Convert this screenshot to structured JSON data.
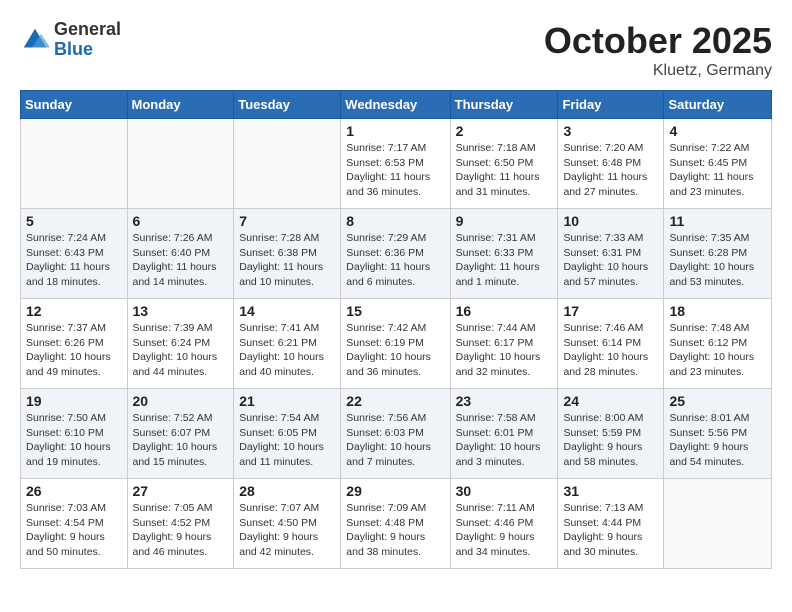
{
  "header": {
    "logo_general": "General",
    "logo_blue": "Blue",
    "month": "October 2025",
    "location": "Kluetz, Germany"
  },
  "weekdays": [
    "Sunday",
    "Monday",
    "Tuesday",
    "Wednesday",
    "Thursday",
    "Friday",
    "Saturday"
  ],
  "weeks": [
    [
      {
        "day": "",
        "info": ""
      },
      {
        "day": "",
        "info": ""
      },
      {
        "day": "",
        "info": ""
      },
      {
        "day": "1",
        "info": "Sunrise: 7:17 AM\nSunset: 6:53 PM\nDaylight: 11 hours\nand 36 minutes."
      },
      {
        "day": "2",
        "info": "Sunrise: 7:18 AM\nSunset: 6:50 PM\nDaylight: 11 hours\nand 31 minutes."
      },
      {
        "day": "3",
        "info": "Sunrise: 7:20 AM\nSunset: 6:48 PM\nDaylight: 11 hours\nand 27 minutes."
      },
      {
        "day": "4",
        "info": "Sunrise: 7:22 AM\nSunset: 6:45 PM\nDaylight: 11 hours\nand 23 minutes."
      }
    ],
    [
      {
        "day": "5",
        "info": "Sunrise: 7:24 AM\nSunset: 6:43 PM\nDaylight: 11 hours\nand 18 minutes."
      },
      {
        "day": "6",
        "info": "Sunrise: 7:26 AM\nSunset: 6:40 PM\nDaylight: 11 hours\nand 14 minutes."
      },
      {
        "day": "7",
        "info": "Sunrise: 7:28 AM\nSunset: 6:38 PM\nDaylight: 11 hours\nand 10 minutes."
      },
      {
        "day": "8",
        "info": "Sunrise: 7:29 AM\nSunset: 6:36 PM\nDaylight: 11 hours\nand 6 minutes."
      },
      {
        "day": "9",
        "info": "Sunrise: 7:31 AM\nSunset: 6:33 PM\nDaylight: 11 hours\nand 1 minute."
      },
      {
        "day": "10",
        "info": "Sunrise: 7:33 AM\nSunset: 6:31 PM\nDaylight: 10 hours\nand 57 minutes."
      },
      {
        "day": "11",
        "info": "Sunrise: 7:35 AM\nSunset: 6:28 PM\nDaylight: 10 hours\nand 53 minutes."
      }
    ],
    [
      {
        "day": "12",
        "info": "Sunrise: 7:37 AM\nSunset: 6:26 PM\nDaylight: 10 hours\nand 49 minutes."
      },
      {
        "day": "13",
        "info": "Sunrise: 7:39 AM\nSunset: 6:24 PM\nDaylight: 10 hours\nand 44 minutes."
      },
      {
        "day": "14",
        "info": "Sunrise: 7:41 AM\nSunset: 6:21 PM\nDaylight: 10 hours\nand 40 minutes."
      },
      {
        "day": "15",
        "info": "Sunrise: 7:42 AM\nSunset: 6:19 PM\nDaylight: 10 hours\nand 36 minutes."
      },
      {
        "day": "16",
        "info": "Sunrise: 7:44 AM\nSunset: 6:17 PM\nDaylight: 10 hours\nand 32 minutes."
      },
      {
        "day": "17",
        "info": "Sunrise: 7:46 AM\nSunset: 6:14 PM\nDaylight: 10 hours\nand 28 minutes."
      },
      {
        "day": "18",
        "info": "Sunrise: 7:48 AM\nSunset: 6:12 PM\nDaylight: 10 hours\nand 23 minutes."
      }
    ],
    [
      {
        "day": "19",
        "info": "Sunrise: 7:50 AM\nSunset: 6:10 PM\nDaylight: 10 hours\nand 19 minutes."
      },
      {
        "day": "20",
        "info": "Sunrise: 7:52 AM\nSunset: 6:07 PM\nDaylight: 10 hours\nand 15 minutes."
      },
      {
        "day": "21",
        "info": "Sunrise: 7:54 AM\nSunset: 6:05 PM\nDaylight: 10 hours\nand 11 minutes."
      },
      {
        "day": "22",
        "info": "Sunrise: 7:56 AM\nSunset: 6:03 PM\nDaylight: 10 hours\nand 7 minutes."
      },
      {
        "day": "23",
        "info": "Sunrise: 7:58 AM\nSunset: 6:01 PM\nDaylight: 10 hours\nand 3 minutes."
      },
      {
        "day": "24",
        "info": "Sunrise: 8:00 AM\nSunset: 5:59 PM\nDaylight: 9 hours\nand 58 minutes."
      },
      {
        "day": "25",
        "info": "Sunrise: 8:01 AM\nSunset: 5:56 PM\nDaylight: 9 hours\nand 54 minutes."
      }
    ],
    [
      {
        "day": "26",
        "info": "Sunrise: 7:03 AM\nSunset: 4:54 PM\nDaylight: 9 hours\nand 50 minutes."
      },
      {
        "day": "27",
        "info": "Sunrise: 7:05 AM\nSunset: 4:52 PM\nDaylight: 9 hours\nand 46 minutes."
      },
      {
        "day": "28",
        "info": "Sunrise: 7:07 AM\nSunset: 4:50 PM\nDaylight: 9 hours\nand 42 minutes."
      },
      {
        "day": "29",
        "info": "Sunrise: 7:09 AM\nSunset: 4:48 PM\nDaylight: 9 hours\nand 38 minutes."
      },
      {
        "day": "30",
        "info": "Sunrise: 7:11 AM\nSunset: 4:46 PM\nDaylight: 9 hours\nand 34 minutes."
      },
      {
        "day": "31",
        "info": "Sunrise: 7:13 AM\nSunset: 4:44 PM\nDaylight: 9 hours\nand 30 minutes."
      },
      {
        "day": "",
        "info": ""
      }
    ]
  ]
}
